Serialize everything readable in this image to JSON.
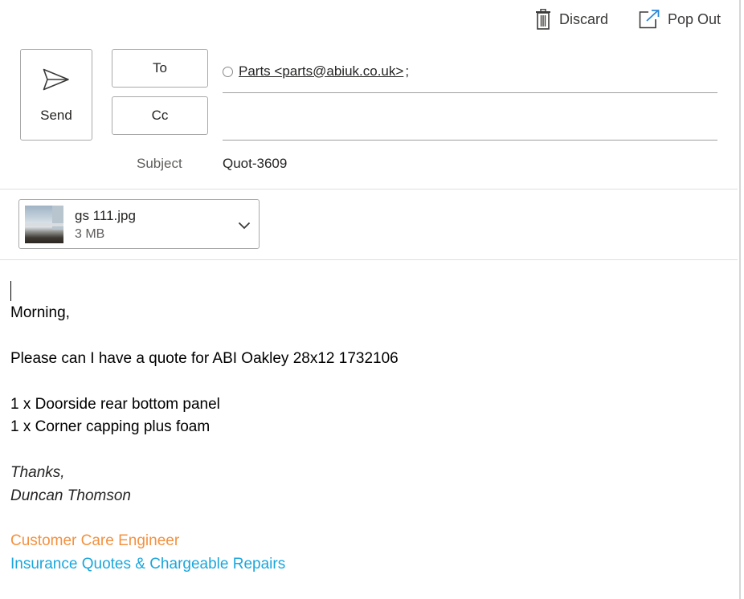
{
  "toolbar": {
    "discard_label": "Discard",
    "discard_icon": "trash-icon",
    "popout_label": "Pop Out",
    "popout_icon": "pop-out-icon"
  },
  "header": {
    "send_label": "Send",
    "send_icon": "send-icon",
    "to_label": "To",
    "cc_label": "Cc",
    "recipients": [
      {
        "display": "Parts <parts@abiuk.co.uk>",
        "separator": ";"
      }
    ],
    "cc_value": "",
    "subject_label": "Subject",
    "subject_value": "Quot-3609"
  },
  "attachment": {
    "name": "gs 111.jpg",
    "size": "3 MB",
    "menu_icon": "chevron-down-icon"
  },
  "body": {
    "greeting": "Morning,",
    "request": "Please can I have a quote for ABI Oakley 28x12 1732106",
    "items": [
      "1 x Doorside rear bottom panel",
      "1 x Corner capping plus foam"
    ],
    "signoff": "Thanks,",
    "signature_name": "Duncan Thomson",
    "signature_title": "Customer Care Engineer",
    "signature_department": "Insurance Quotes & Chargeable Repairs"
  },
  "colors": {
    "signature_title": "#f4913f",
    "signature_department": "#1aa6dc",
    "border": "#a9a9a9",
    "text": "#252423"
  }
}
